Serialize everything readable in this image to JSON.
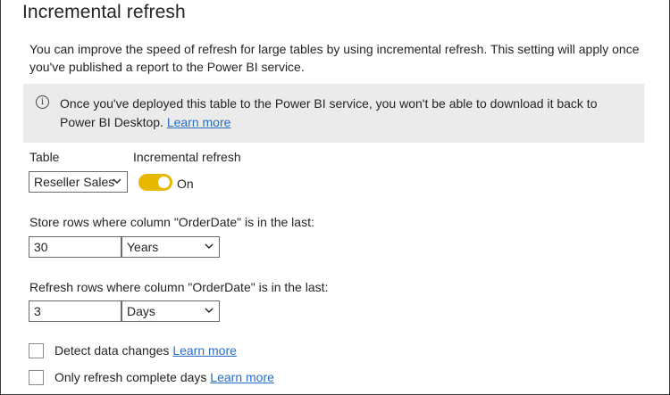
{
  "panel": {
    "title": "Incremental refresh",
    "description": "You can improve the speed of refresh for large tables by using incremental refresh. This setting will apply once you've published a report to the Power BI service."
  },
  "banner": {
    "icon": "info-icon",
    "text_line1": "Once you've deployed this table to the Power BI service, you won't be able to download it back to",
    "text_line2": "Power BI Desktop.",
    "link": "Learn more"
  },
  "table": {
    "label": "Table",
    "selected": "Reseller Sales"
  },
  "incremental": {
    "label": "Incremental refresh",
    "state": "On",
    "color": "#e6b800"
  },
  "store": {
    "label": "Store rows where column \"OrderDate\" is in the last:",
    "value": "30",
    "unit": "Years"
  },
  "refresh": {
    "label": "Refresh rows where column \"OrderDate\" is in the last:",
    "value": "3",
    "unit": "Days"
  },
  "options": [
    {
      "label": "Detect data changes",
      "link": "Learn more",
      "checked": false
    },
    {
      "label": "Only refresh complete days",
      "link": "Learn more",
      "checked": false
    }
  ]
}
